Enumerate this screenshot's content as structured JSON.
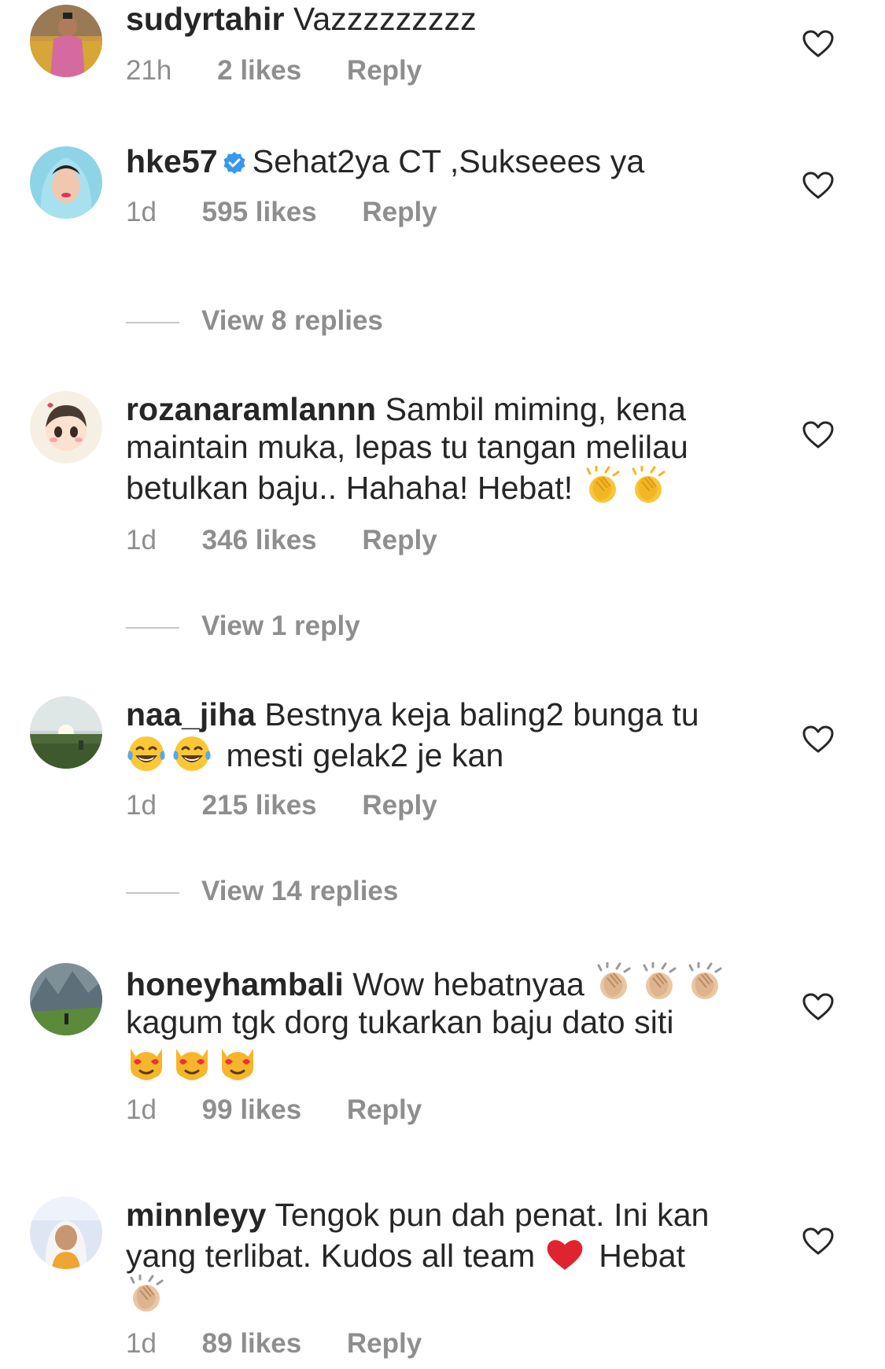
{
  "comments": [
    {
      "username": "sudyrtahir",
      "verified": false,
      "text_parts": [
        "Vazzzzzzzzz"
      ],
      "time": "21h",
      "likes": "2 likes",
      "reply": "Reply"
    },
    {
      "username": "hke57",
      "verified": true,
      "text_parts": [
        "Sehat2ya  CT ,Sukseees ya"
      ],
      "time": "1d",
      "likes": "595 likes",
      "reply": "Reply",
      "view_replies": "View 8 replies"
    },
    {
      "username": "rozanaramlannn",
      "verified": false,
      "text_parts": [
        "Sambil miming, kena maintain muka, lepas tu tangan melilau betulkan baju.. Hahaha! Hebat!"
      ],
      "emojis": [
        "clapping-hands",
        "clapping-hands"
      ],
      "time": "1d",
      "likes": "346 likes",
      "reply": "Reply",
      "view_replies": "View 1 reply"
    },
    {
      "username": "naa_jiha",
      "verified": false,
      "text_parts": [
        "Bestnya keja baling2 bunga tu",
        "mesti gelak2 je kan"
      ],
      "emojis": [
        "tears-of-joy",
        "tears-of-joy"
      ],
      "time": "1d",
      "likes": "215 likes",
      "reply": "Reply",
      "view_replies": "View 14 replies"
    },
    {
      "username": "honeyhambali",
      "verified": false,
      "text_parts": [
        "Wow hebatnyaa",
        "kagum tgk dorg tukarkan baju dato siti"
      ],
      "emojis": [
        "clapping-hands-light",
        "clapping-hands-light",
        "clapping-hands-light",
        "heart-eyes-cat",
        "heart-eyes-cat",
        "heart-eyes-cat"
      ],
      "time": "1d",
      "likes": "99 likes",
      "reply": "Reply"
    },
    {
      "username": "minnleyy",
      "verified": false,
      "text_parts": [
        "Tengok pun dah penat. Ini kan yang terlibat. Kudos all team",
        "Hebat"
      ],
      "emojis": [
        "red-heart",
        "clapping-hands-light"
      ],
      "time": "1d",
      "likes": "89 likes",
      "reply": "Reply"
    }
  ],
  "colors": {
    "text": "#262626",
    "secondary": "#8e8e8e",
    "verified": "#3897f0",
    "divider": "#c7c7c7"
  }
}
